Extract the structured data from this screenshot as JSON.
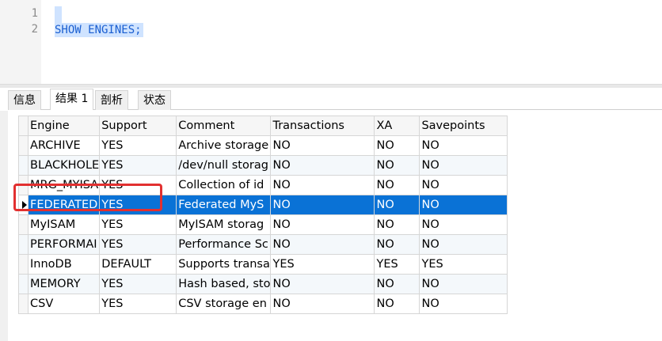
{
  "editor": {
    "line_numbers": [
      "1",
      "2"
    ],
    "code_line": "SHOW ENGINES;"
  },
  "tabs": [
    "信息",
    "结果 1",
    "剖析",
    "状态"
  ],
  "active_tab": "结果 1",
  "grid": {
    "columns": [
      "Engine",
      "Support",
      "Comment",
      "Transactions",
      "XA",
      "Savepoints"
    ],
    "rows": [
      [
        "ARCHIVE",
        "YES",
        "Archive storage",
        "NO",
        "NO",
        "NO"
      ],
      [
        "BLACKHOLE",
        "YES",
        "/dev/null storag",
        "NO",
        "NO",
        "NO"
      ],
      [
        "MRG_MYISA",
        "YES",
        "Collection of id",
        "NO",
        "NO",
        "NO"
      ],
      [
        "FEDERATED",
        "YES",
        "Federated MyS",
        "NO",
        "NO",
        "NO"
      ],
      [
        "MyISAM",
        "YES",
        "MyISAM storag",
        "NO",
        "NO",
        "NO"
      ],
      [
        "PERFORMAI",
        "YES",
        "Performance Sc",
        "NO",
        "NO",
        "NO"
      ],
      [
        "InnoDB",
        "DEFAULT",
        "Supports transa",
        "YES",
        "YES",
        "YES"
      ],
      [
        "MEMORY",
        "YES",
        "Hash based, sto",
        "NO",
        "NO",
        "NO"
      ],
      [
        "CSV",
        "YES",
        "CSV storage en",
        "NO",
        "NO",
        "NO"
      ]
    ],
    "selected_row": "FEDERATED"
  },
  "colors": {
    "selection": "#0a72d6",
    "code_text": "#1b5fd1",
    "highlight_box": "#e23030"
  }
}
